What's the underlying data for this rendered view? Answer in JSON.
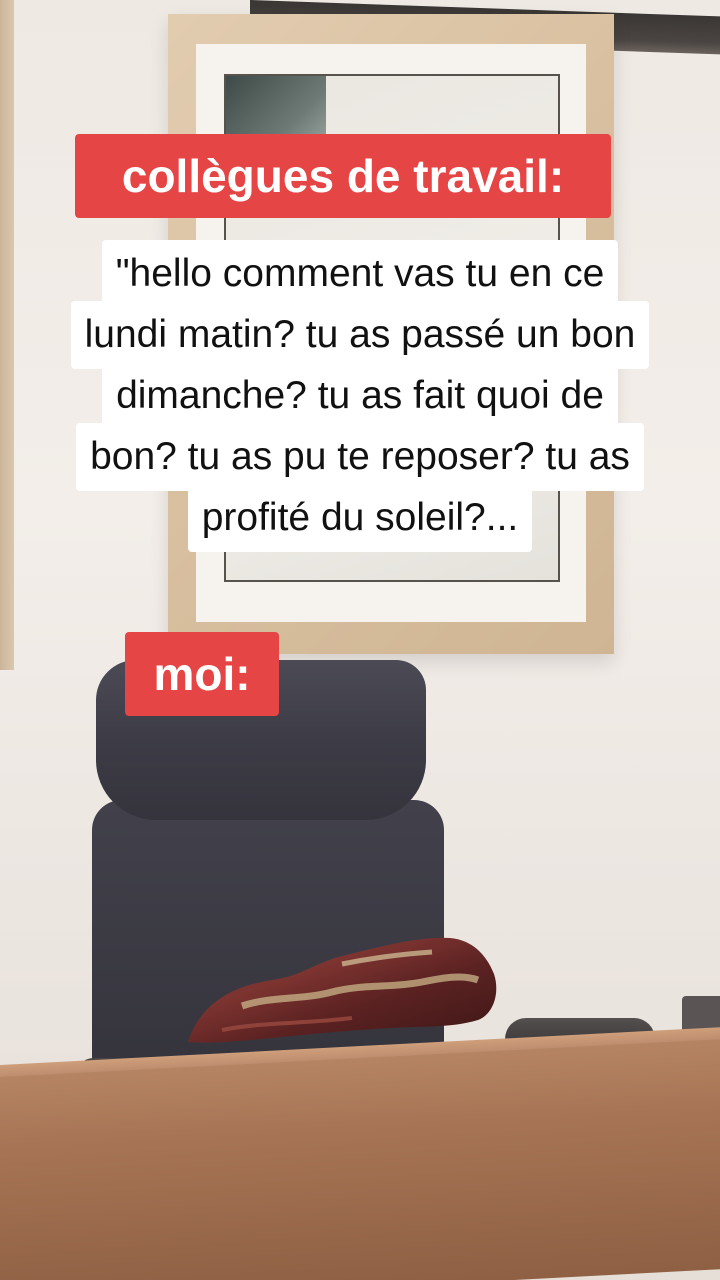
{
  "captions": {
    "colleagues_label": "collègues de travail:",
    "quote_lines": [
      "\"hello comment vas tu en ce",
      "lundi matin? tu as passé un bon",
      "dimanche? tu as fait quoi de",
      "bon? tu as pu te reposer? tu as",
      "profité du soleil?..."
    ],
    "me_label": "moi:"
  },
  "colors": {
    "caption_red": "#e64545",
    "caption_text": "#ffffff",
    "quote_bg": "#ffffff",
    "quote_text": "#111111"
  }
}
